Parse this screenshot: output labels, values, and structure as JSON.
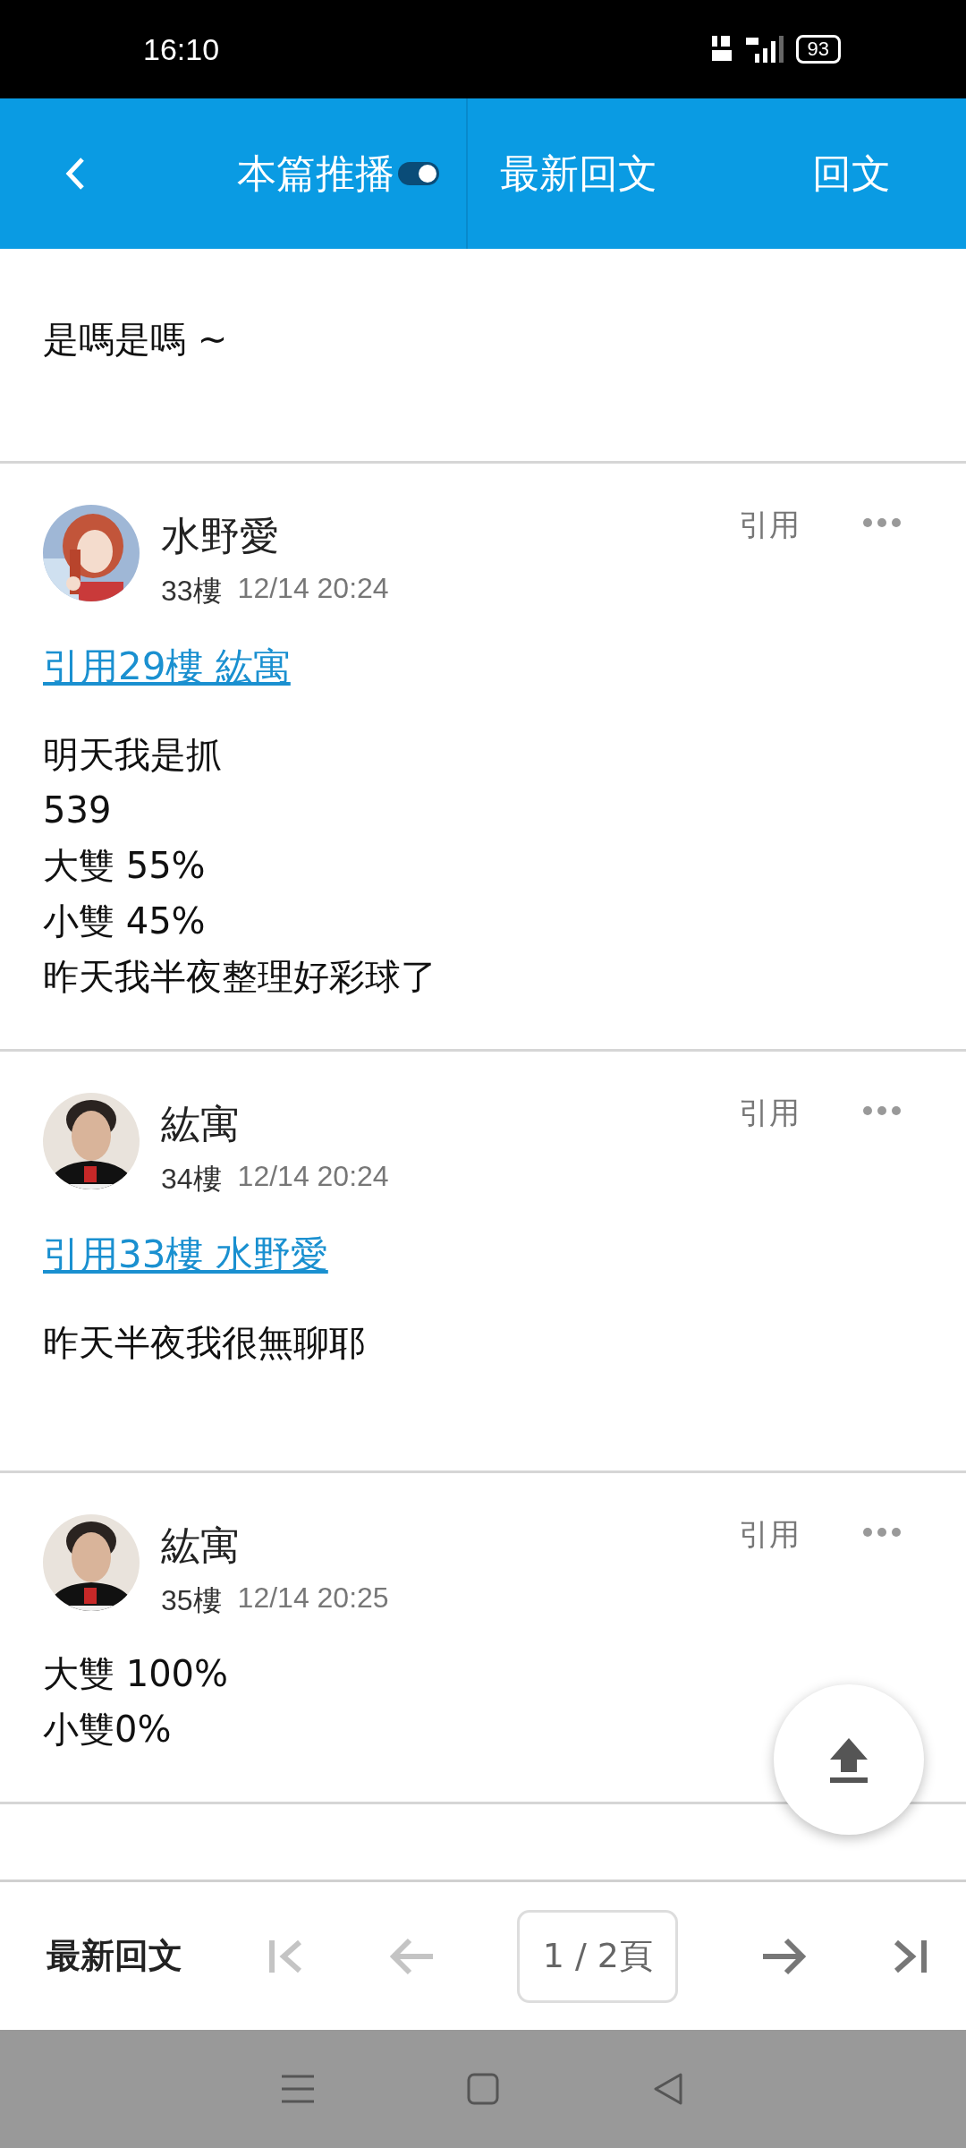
{
  "status_bar": {
    "time": "16:10",
    "battery": "93"
  },
  "header": {
    "push": {
      "label": "本篇推播",
      "on": true
    },
    "tabs": [
      {
        "label": "最新回文"
      },
      {
        "label": "回文"
      }
    ]
  },
  "posts": [
    {
      "lines": [
        "是嗎是嗎 ~"
      ]
    },
    {
      "author": "水野愛",
      "avatar": {
        "kind": "picture"
      },
      "floor": "33樓",
      "time": "12/14 20:24",
      "quote_action": "引用",
      "quote": "引用29樓 紘寓",
      "lines": [
        "明天我是抓",
        "539",
        "大雙 55%",
        "小雙 45%",
        "昨天我半夜整理好彩球了"
      ]
    },
    {
      "author": "紘寓",
      "avatar": {
        "kind": "picture"
      },
      "floor": "34樓",
      "time": "12/14 20:24",
      "quote_action": "引用",
      "quote": "引用33樓 水野愛",
      "lines": [
        "昨天半夜我很無聊耶"
      ]
    },
    {
      "author": "紘寓",
      "avatar": {
        "kind": "picture"
      },
      "floor": "35樓",
      "time": "12/14 20:25",
      "quote_action": "引用",
      "lines": [
        "大雙 100%",
        "小雙0%"
      ]
    }
  ],
  "bottom_bar": {
    "latest": "最新回文",
    "first": {
      "disabled": true
    },
    "prev": {
      "disabled": true
    },
    "page": "1 / 2頁",
    "next": {
      "disabled": false
    },
    "last": {
      "disabled": false
    }
  }
}
